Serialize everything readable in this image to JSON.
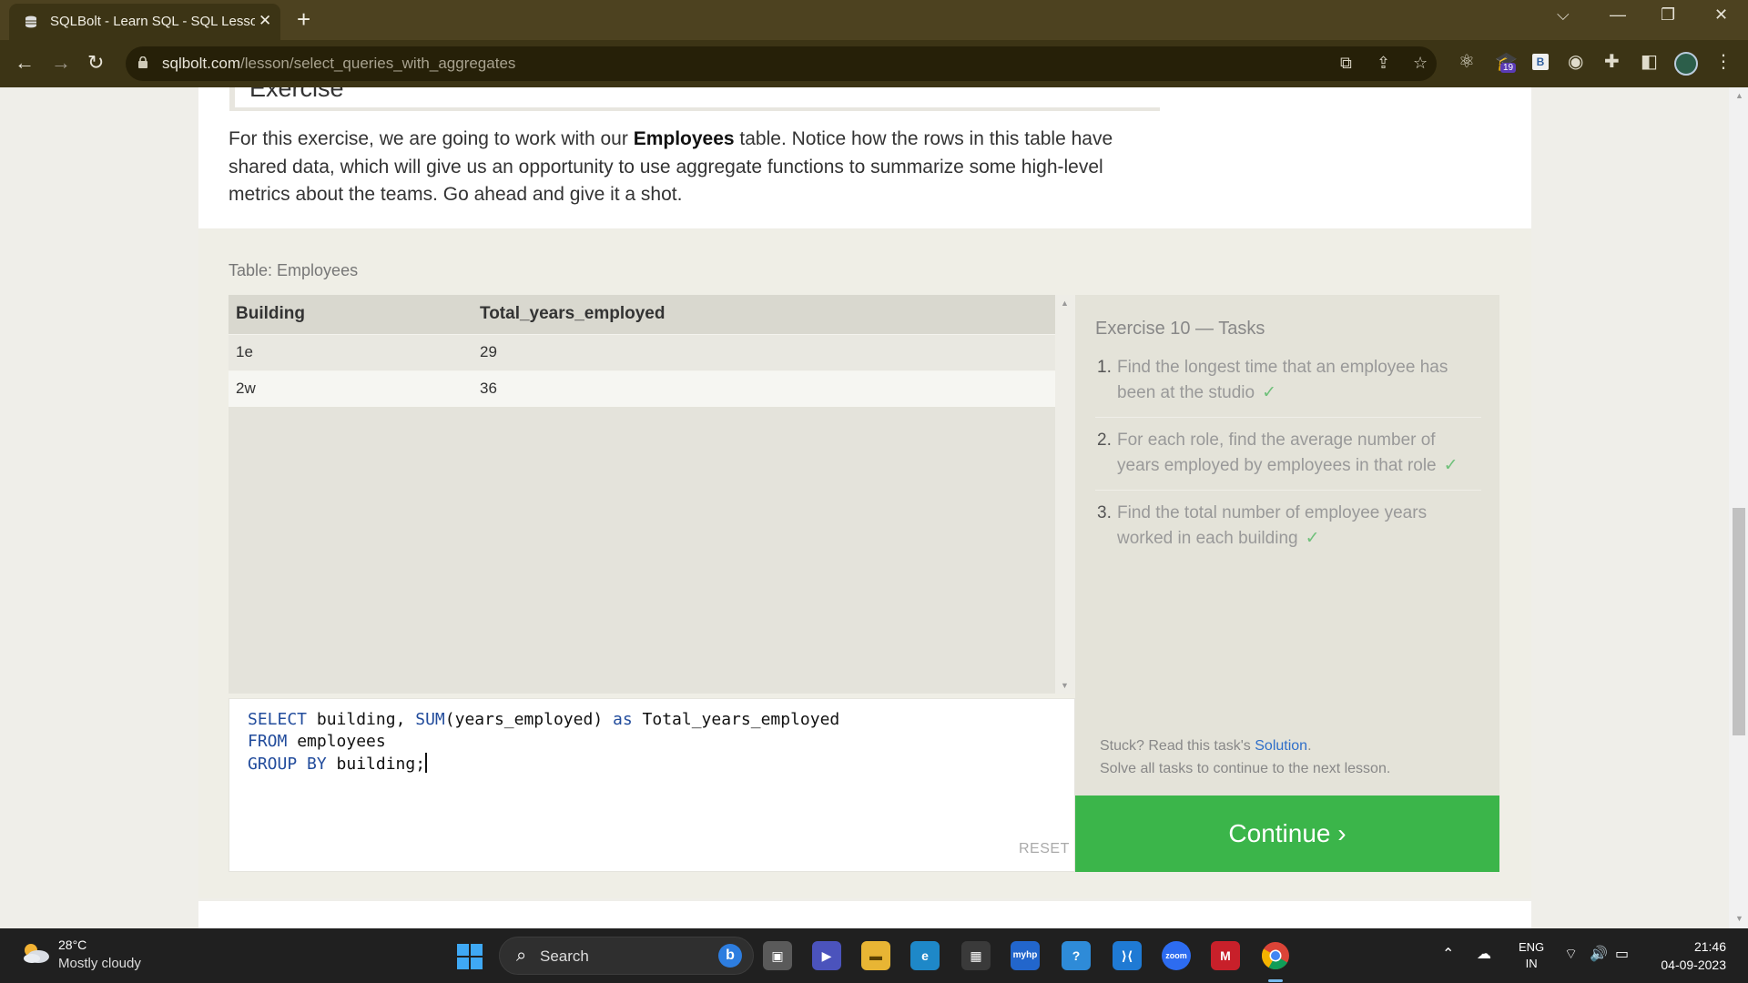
{
  "browser": {
    "tab_title": "SQLBolt - Learn SQL - SQL Lesson",
    "url_domain": "sqlbolt.com",
    "url_path": "/lesson/select_queries_with_aggregates",
    "extension_badge": "19",
    "extension_b": "B"
  },
  "page": {
    "exercise_heading": "Exercise",
    "intro_before": "For this exercise, we are going to work with our ",
    "intro_bold": "Employees",
    "intro_after": " table. Notice how the rows in this table have shared data, which will give us an opportunity to use aggregate functions to summarize some high-level metrics about the teams. Go ahead and give it a shot.",
    "table_caption": "Table: Employees",
    "result": {
      "columns": [
        "Building",
        "Total_years_employed"
      ],
      "rows": [
        [
          "1e",
          "29"
        ],
        [
          "2w",
          "36"
        ]
      ]
    },
    "editor": {
      "line1_kw1": "SELECT",
      "line1_a": " building, ",
      "line1_kw2": "SUM",
      "line1_b": "(years_employed) ",
      "line1_kw3": "as",
      "line1_c": " Total_years_employed",
      "line2_kw": "FROM",
      "line2_rest": " employees",
      "line3_kw": "GROUP BY",
      "line3_rest": " building;",
      "reset_label": "RESET"
    },
    "tasks": {
      "title": "Exercise 10 — Tasks",
      "items": [
        {
          "num": "1.",
          "text": "Find the longest time that an employee has been at the studio",
          "check": "✓"
        },
        {
          "num": "2.",
          "text": "For each role, find the average number of years employed by employees in that role",
          "check": "✓"
        },
        {
          "num": "3.",
          "text": "Find the total number of employee years worked in each building",
          "check": "✓"
        }
      ],
      "stuck_prefix": "Stuck? Read this task's ",
      "solution_link": "Solution",
      "stuck_suffix": ".",
      "solve_all": "Solve all tasks to continue to the next lesson."
    },
    "continue_label": "Continue ›"
  },
  "taskbar": {
    "temperature": "28°C",
    "weather": "Mostly cloudy",
    "search_placeholder": "Search",
    "lang_line1": "ENG",
    "lang_line2": "IN",
    "time": "21:46",
    "date": "04-09-2023"
  },
  "colors": {
    "continue_green": "#3bb54a",
    "keyword_blue": "#224c9c",
    "check_green": "#6fc07a",
    "link_blue": "#2f6fc9"
  }
}
